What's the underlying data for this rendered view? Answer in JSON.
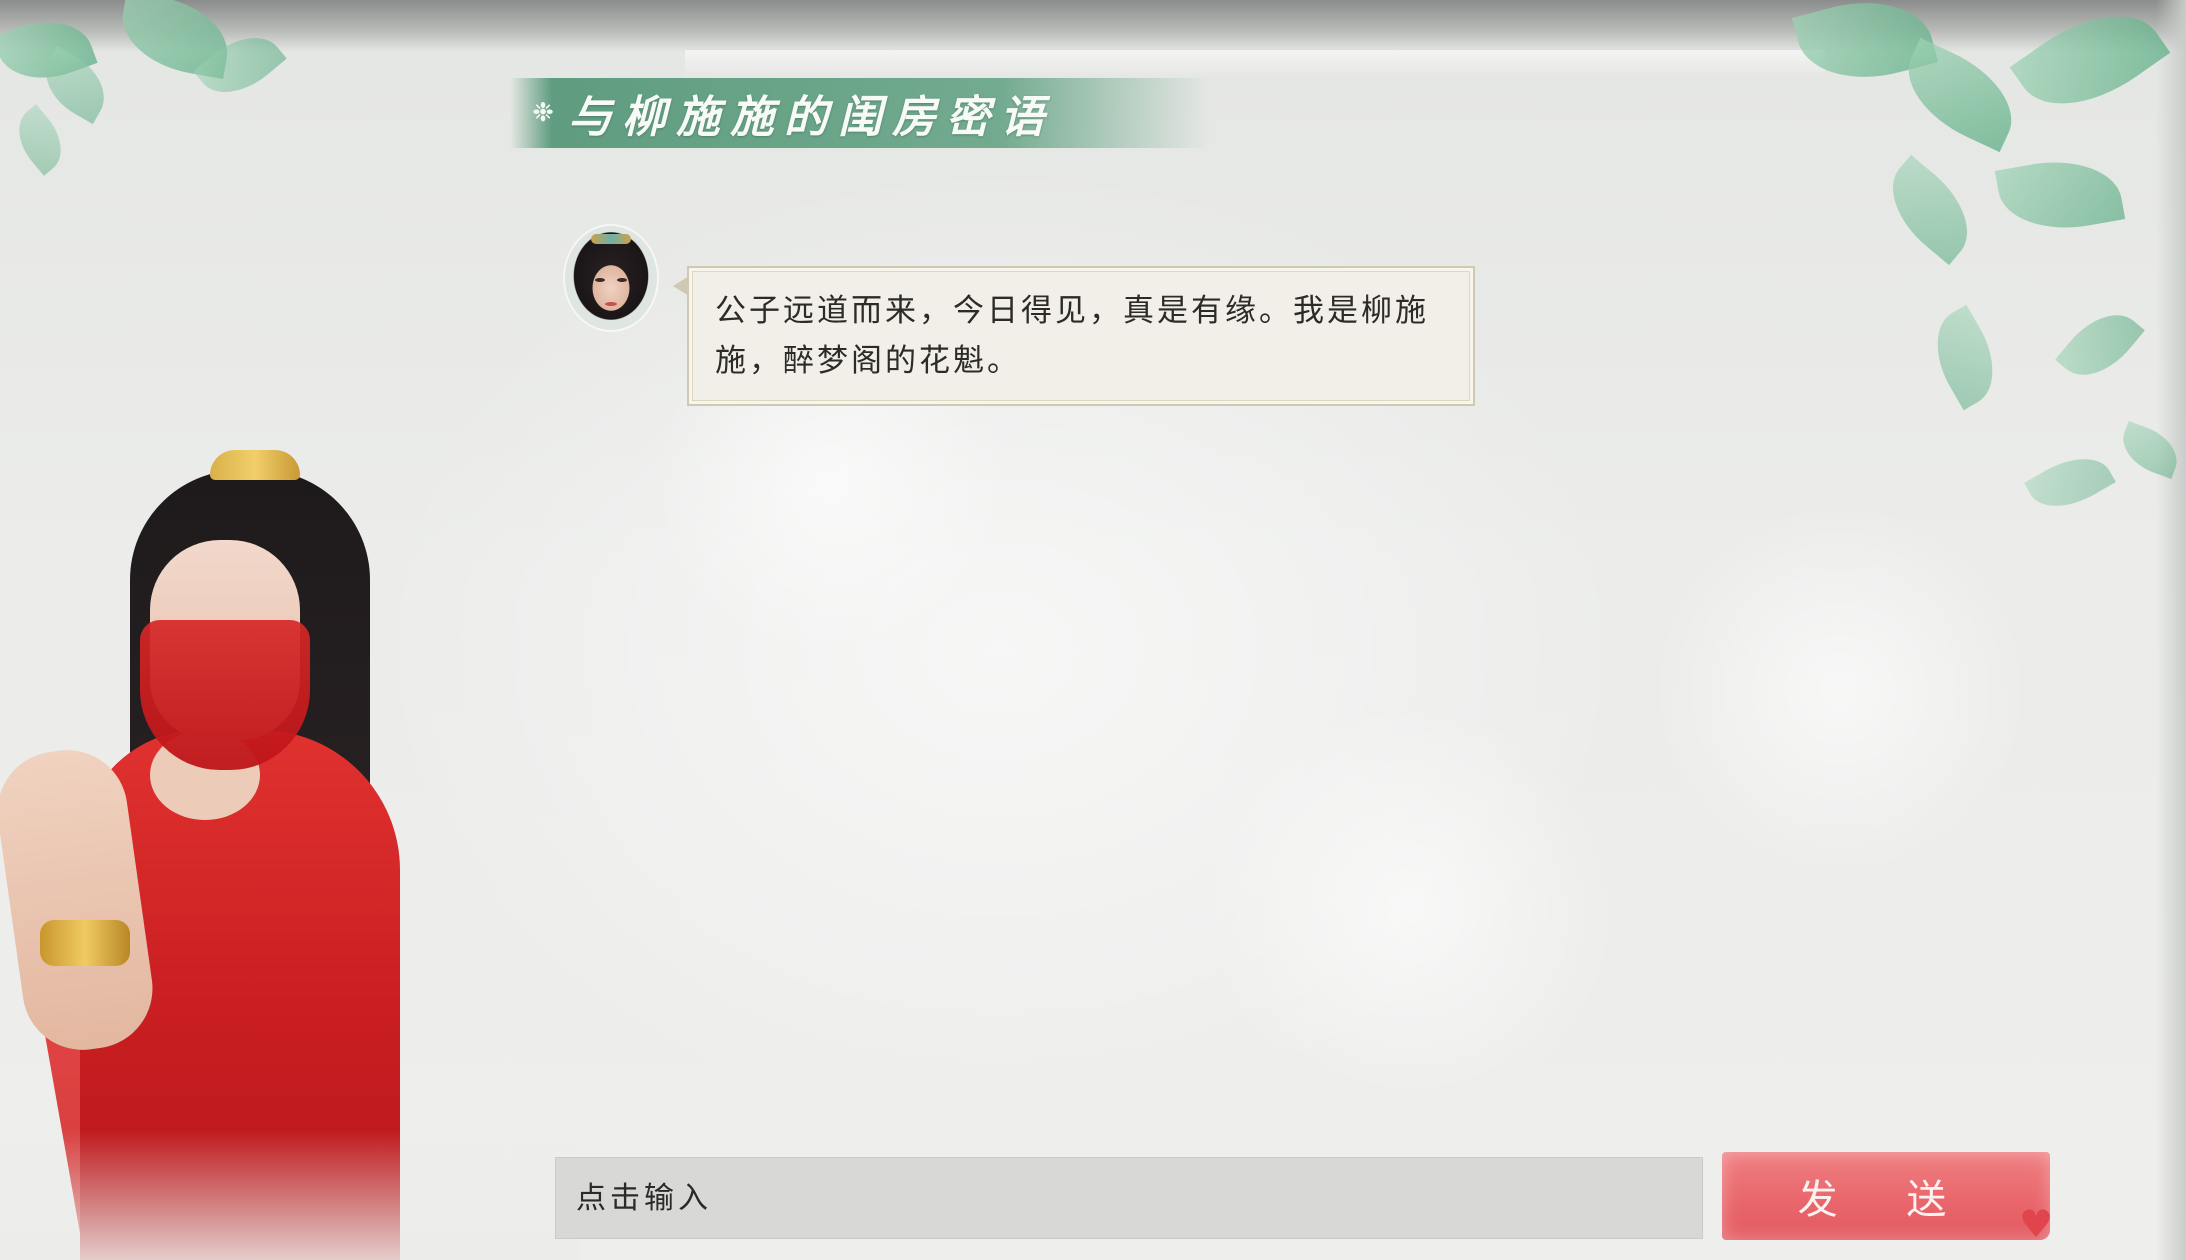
{
  "header": {
    "title_icon": "snowflake-icon",
    "title": "与柳施施的闺房密语"
  },
  "chat": {
    "messages": [
      {
        "sender": "npc",
        "avatar": "npc-avatar",
        "text": "公子远道而来，今日得见，真是有缘。我是柳施施，醉梦阁的花魁。"
      }
    ]
  },
  "composer": {
    "placeholder": "点击输入",
    "value": "",
    "send_label": "发 送"
  },
  "colors": {
    "banner": "#5ea080",
    "send_button": "#e9676c",
    "bubble_bg": "#f1efe7",
    "bubble_border": "#cfc9b3",
    "input_bg": "#d8d8d6"
  }
}
